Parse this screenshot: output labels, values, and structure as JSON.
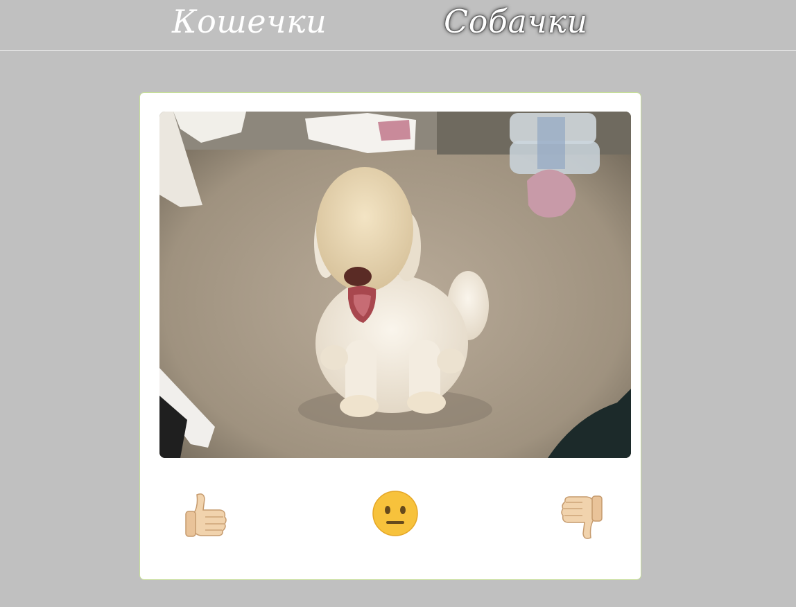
{
  "nav": {
    "tabs": [
      {
        "label": "Кошечки",
        "active": false
      },
      {
        "label": "Собачки",
        "active": true
      }
    ]
  },
  "card": {
    "photo": {
      "subject": "dog-photo"
    },
    "buttons": [
      {
        "icon": "thumbs-up-icon"
      },
      {
        "icon": "neutral-face-icon"
      },
      {
        "icon": "thumbs-down-icon"
      }
    ]
  },
  "colors": {
    "background": "#c0c0c0",
    "card_border": "#c6dd9a",
    "emoji_yellow": "#f7c23c"
  }
}
